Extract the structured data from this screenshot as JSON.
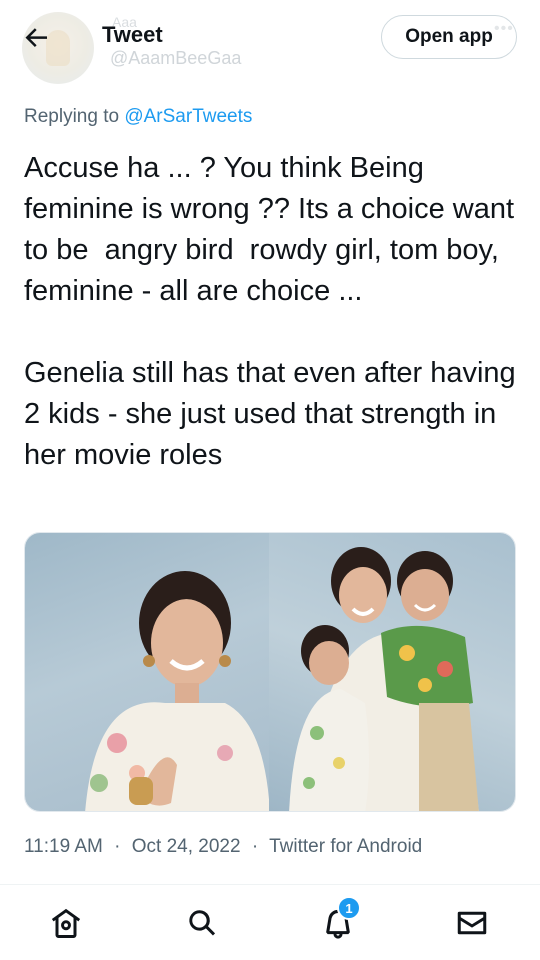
{
  "header": {
    "title": "Tweet",
    "ghost_name": "Aaa",
    "ghost_handle": "@AaamBeeGaa",
    "open_app_label": "Open app"
  },
  "reply": {
    "prefix": "Replying to",
    "handle": "@ArSarTweets"
  },
  "tweet": {
    "paragraph1": "Accuse ha ... ? You think Being feminine is wrong ?? Its a choice want to be  angry bird  rowdy girl, tom boy, feminine - all are choice ...",
    "paragraph2": "Genelia still has that even after having 2 kids - she just used that strength in her movie roles"
  },
  "meta": {
    "time": "11:19 AM",
    "separator": "·",
    "date": "Oct 24, 2022",
    "source": "Twitter for Android"
  },
  "nav": {
    "notification_count": "1"
  },
  "colors": {
    "accent": "#1d9bf0",
    "text_primary": "#0f1419",
    "text_secondary": "#536471"
  },
  "icons": [
    "back-arrow-icon",
    "home-icon",
    "search-icon",
    "notifications-bell-icon",
    "messages-mail-icon"
  ]
}
